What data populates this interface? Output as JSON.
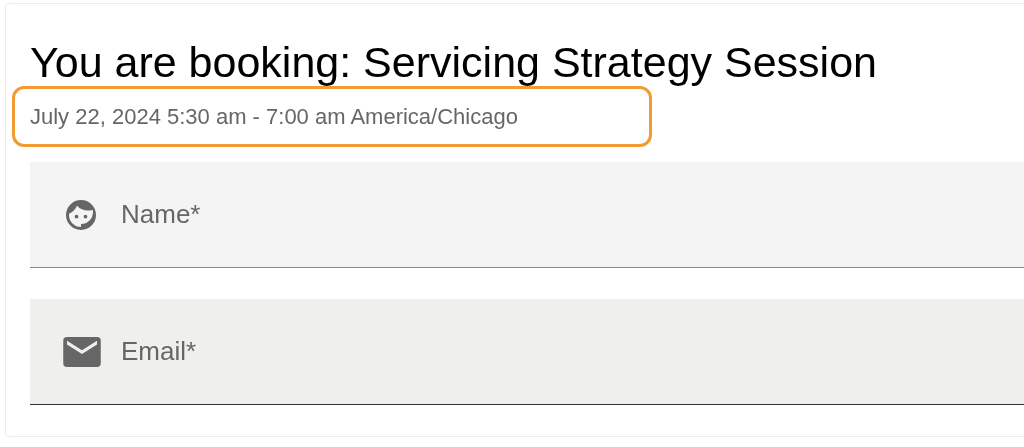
{
  "heading": "You are booking: Servicing Strategy Session",
  "schedule": "July 22, 2024 5:30 am - 7:00 am America/Chicago",
  "fields": [
    {
      "kind": "name",
      "placeholder": "Name*"
    },
    {
      "kind": "email",
      "placeholder": "Email*"
    }
  ]
}
